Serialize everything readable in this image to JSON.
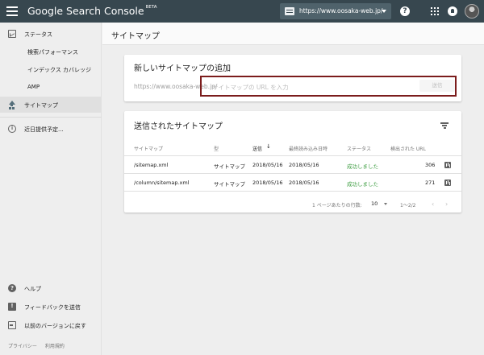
{
  "app": {
    "title": "Google Search Console",
    "badge": "BETA",
    "property": "https://www.oosaka-web.jp/"
  },
  "topbar": {
    "icons": [
      "menu-icon",
      "property-icon",
      "help-icon",
      "apps-icon",
      "notifications-icon",
      "avatar"
    ]
  },
  "sidebar": {
    "items": [
      {
        "label": "ステータス",
        "icon": "status-icon"
      },
      {
        "label": "検索パフォーマンス"
      },
      {
        "label": "インデックス カバレッジ"
      },
      {
        "label": "AMP"
      },
      {
        "label": "サイトマップ",
        "icon": "upload-icon",
        "active": true
      },
      {
        "label": "近日提供予定...",
        "icon": "info-icon"
      }
    ],
    "bottom": [
      {
        "label": "ヘルプ",
        "icon": "help-icon"
      },
      {
        "label": "フィードバックを送信",
        "icon": "feedback-icon"
      },
      {
        "label": "以前のバージョンに戻す",
        "icon": "exit-icon"
      }
    ],
    "footer": {
      "privacy": "プライバシー",
      "terms": "利用規約"
    }
  },
  "page": {
    "title": "サイトマップ"
  },
  "add_card": {
    "title": "新しいサイトマップの追加",
    "url_prefix": "https://www.oosaka-web.jp/",
    "placeholder": "サイトマップの URL を入力",
    "submit_label": "送信"
  },
  "submitted_card": {
    "title": "送信されたサイトマップ",
    "columns": [
      "サイトマップ",
      "型",
      "送信",
      "最終読み込み日時",
      "ステータス",
      "検出された URL"
    ],
    "sort_column": "送信",
    "rows": [
      {
        "sitemap": "/sitemap.xml",
        "type": "サイトマップ",
        "submitted": "2018/05/16",
        "last_read": "2018/05/16",
        "status": "成功しました",
        "urls": "306"
      },
      {
        "sitemap": "/column/sitemap.xml",
        "type": "サイトマップ",
        "submitted": "2018/05/16",
        "last_read": "2018/05/16",
        "status": "成功しました",
        "urls": "271"
      }
    ],
    "pagination": {
      "rows_per_page_label": "1 ページあたりの行数:",
      "rows_per_page": "10",
      "range": "1〜2/2",
      "prev": "‹",
      "next": "›"
    }
  },
  "colors": {
    "topbar": "#37474f",
    "success": "#43a047",
    "highlight": "#7b1c1c"
  }
}
